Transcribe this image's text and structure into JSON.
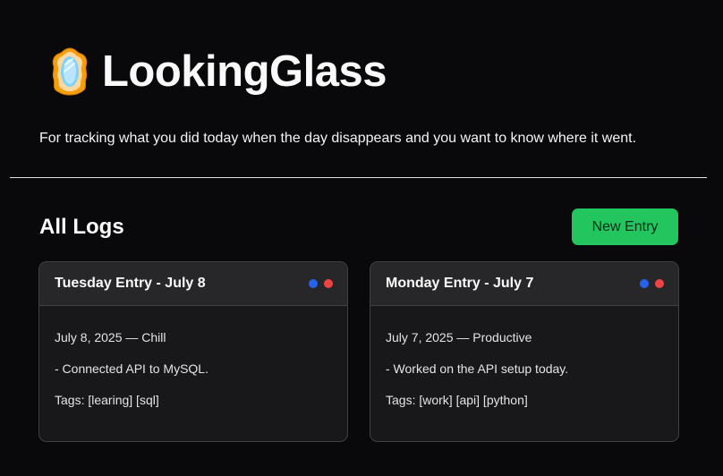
{
  "app": {
    "title": "LookingGlass",
    "tagline": "For tracking what you did today when the day disappears and you want to know where it went.",
    "logo_icon": "mirror-icon"
  },
  "logs": {
    "heading": "All Logs",
    "new_entry_label": "New Entry",
    "entries": [
      {
        "title": "Tuesday Entry - July 8",
        "date_mood": "July 8, 2025 — Chill",
        "summary": "- Connected API to MySQL.",
        "tags": "Tags: [learing] [sql]"
      },
      {
        "title": "Monday Entry - July 7",
        "date_mood": "July 7, 2025 — Productive",
        "summary": "- Worked on the API setup today.",
        "tags": "Tags: [work] [api] [python]"
      }
    ]
  },
  "colors": {
    "background": "#09090b",
    "accent_green": "#22c55e",
    "dot_blue": "#2563eb",
    "dot_red": "#ef4444",
    "card_bg": "#18181b",
    "card_header_bg": "#27272a"
  }
}
